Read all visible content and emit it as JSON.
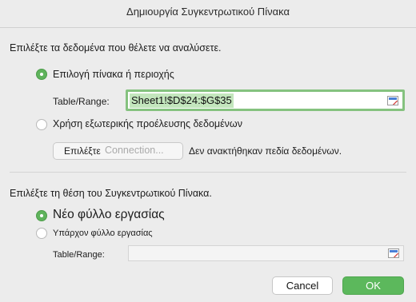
{
  "window": {
    "title": "Δημιουργία Συγκεντρωτικού Πίνακα"
  },
  "data_section": {
    "heading": "Επιλέξτε τα δεδομένα που θέλετε να αναλύσετε.",
    "option_table_range": {
      "label": "Επιλογή πίνακα ή περιοχής",
      "selected": true
    },
    "table_range_label": "Table/Range:",
    "table_range_value": "Sheet1!$D$24:$G$35",
    "option_external": {
      "label": "Χρήση εξωτερικής προέλευσης δεδομένων",
      "selected": false
    },
    "connection_button": {
      "prefix": "Επιλέξτε",
      "label": "Connection..."
    },
    "no_fields_text": "Δεν ανακτήθηκαν πεδία δεδομένων."
  },
  "location_section": {
    "heading": "Επιλέξτε τη θέση του Συγκεντρωτικού Πίνακα.",
    "option_new_sheet": {
      "label": "Νέο φύλλο εργασίας",
      "selected": true
    },
    "option_existing_sheet": {
      "label": "Υπάρχον φύλλο εργασίας",
      "selected": false
    },
    "table_range_label": "Table/Range:",
    "table_range_value": ""
  },
  "buttons": {
    "cancel": "Cancel",
    "ok": "OK"
  },
  "colors": {
    "accent_green": "#5cb85c",
    "selection_green": "#c3e6bd",
    "background": "#ececec"
  }
}
